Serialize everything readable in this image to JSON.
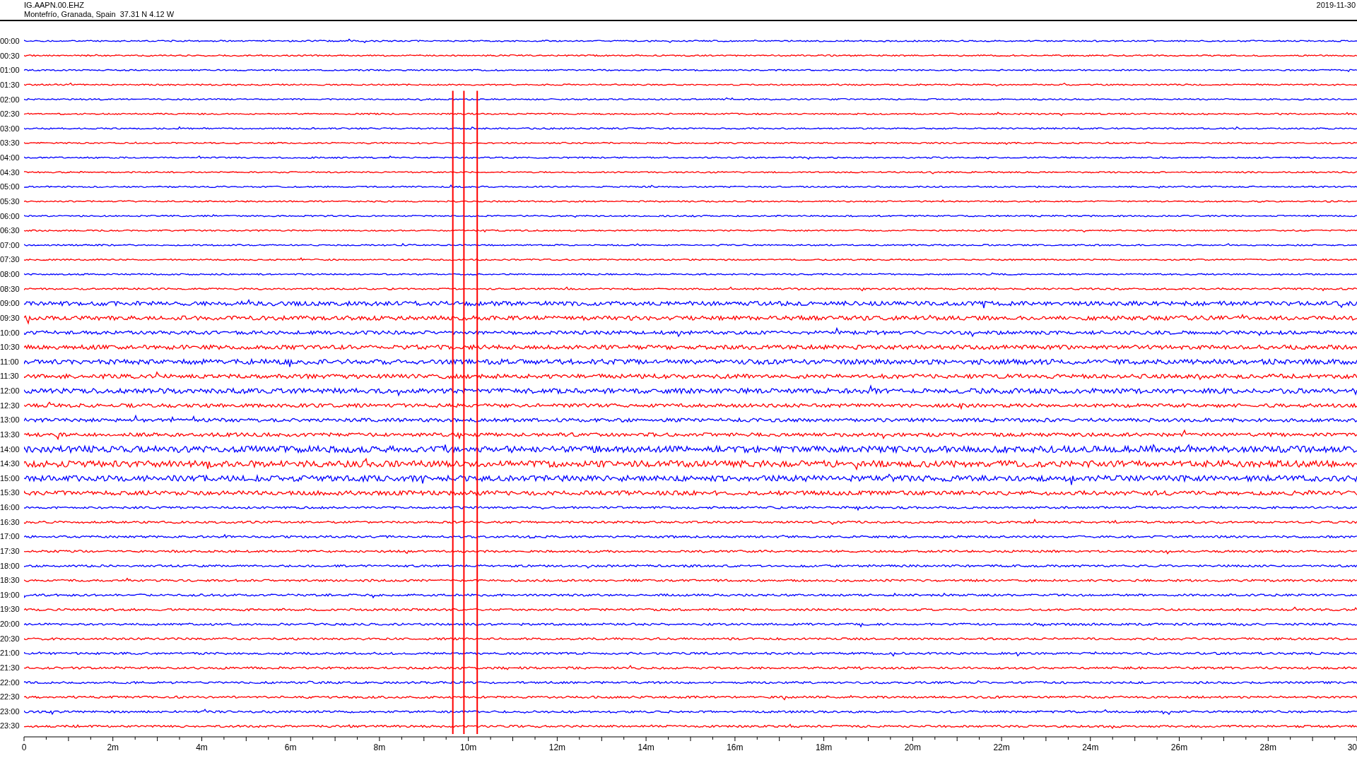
{
  "header": {
    "station": "IG.AAPN.00.EHZ",
    "location": "Montefrío, Granada, Spain  37.31 N 4.12 W",
    "date": "2019-11-30"
  },
  "rows": [
    {
      "time": "00:00",
      "color": "#0000ff"
    },
    {
      "time": "00:30",
      "color": "#ff0000"
    },
    {
      "time": "01:00",
      "color": "#0000ff"
    },
    {
      "time": "01:30",
      "color": "#ff0000"
    },
    {
      "time": "02:00",
      "color": "#0000ff"
    },
    {
      "time": "02:30",
      "color": "#ff0000"
    },
    {
      "time": "03:00",
      "color": "#0000ff"
    },
    {
      "time": "03:30",
      "color": "#ff0000"
    },
    {
      "time": "04:00",
      "color": "#0000ff"
    },
    {
      "time": "04:30",
      "color": "#ff0000"
    },
    {
      "time": "05:00",
      "color": "#0000ff"
    },
    {
      "time": "05:30",
      "color": "#ff0000"
    },
    {
      "time": "06:00",
      "color": "#0000ff"
    },
    {
      "time": "06:30",
      "color": "#ff0000"
    },
    {
      "time": "07:00",
      "color": "#0000ff"
    },
    {
      "time": "07:30",
      "color": "#ff0000"
    },
    {
      "time": "08:00",
      "color": "#0000ff"
    },
    {
      "time": "08:30",
      "color": "#ff0000"
    },
    {
      "time": "09:00",
      "color": "#0000ff"
    },
    {
      "time": "09:30",
      "color": "#ff0000"
    },
    {
      "time": "10:00",
      "color": "#0000ff"
    },
    {
      "time": "10:30",
      "color": "#ff0000"
    },
    {
      "time": "11:00",
      "color": "#0000ff"
    },
    {
      "time": "11:30",
      "color": "#ff0000"
    },
    {
      "time": "12:00",
      "color": "#0000ff"
    },
    {
      "time": "12:30",
      "color": "#ff0000"
    },
    {
      "time": "13:00",
      "color": "#0000ff"
    },
    {
      "time": "13:30",
      "color": "#ff0000"
    },
    {
      "time": "14:00",
      "color": "#0000ff"
    },
    {
      "time": "14:30",
      "color": "#ff0000"
    },
    {
      "time": "15:00",
      "color": "#0000ff"
    },
    {
      "time": "15:30",
      "color": "#ff0000"
    },
    {
      "time": "16:00",
      "color": "#0000ff"
    },
    {
      "time": "16:30",
      "color": "#ff0000"
    },
    {
      "time": "17:00",
      "color": "#0000ff"
    },
    {
      "time": "17:30",
      "color": "#ff0000"
    },
    {
      "time": "18:00",
      "color": "#0000ff"
    },
    {
      "time": "18:30",
      "color": "#ff0000"
    },
    {
      "time": "19:00",
      "color": "#0000ff"
    },
    {
      "time": "19:30",
      "color": "#ff0000"
    },
    {
      "time": "20:00",
      "color": "#0000ff"
    },
    {
      "time": "20:30",
      "color": "#ff0000"
    },
    {
      "time": "21:00",
      "color": "#0000ff"
    },
    {
      "time": "21:30",
      "color": "#ff0000"
    },
    {
      "time": "22:00",
      "color": "#0000ff"
    },
    {
      "time": "22:30",
      "color": "#ff0000"
    },
    {
      "time": "23:00",
      "color": "#0000ff"
    },
    {
      "time": "23:30",
      "color": "#ff0000"
    }
  ],
  "x_axis": {
    "ticks": [
      "0",
      "2m",
      "4m",
      "6m",
      "8m",
      "10m",
      "12m",
      "14m",
      "16m",
      "18m",
      "20m",
      "22m",
      "24m",
      "26m",
      "28m",
      "30"
    ]
  }
}
